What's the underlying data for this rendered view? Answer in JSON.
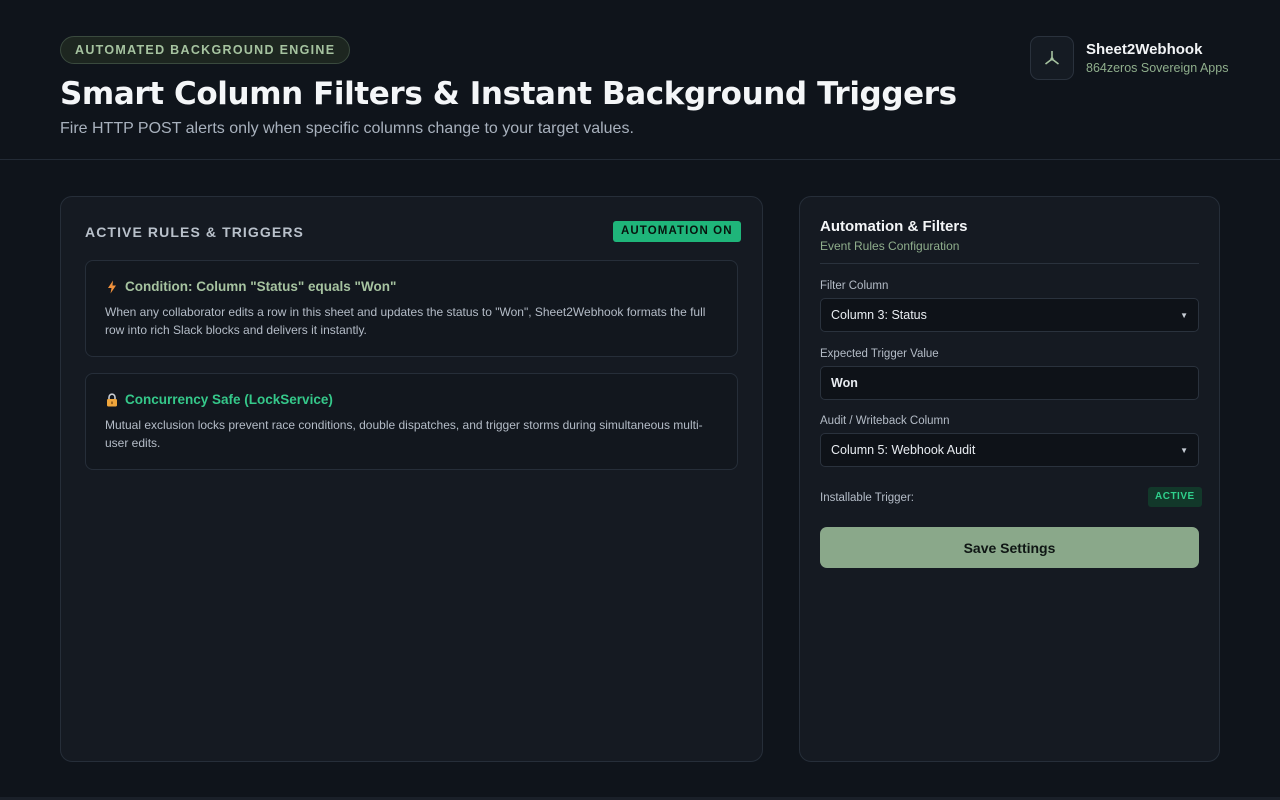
{
  "header": {
    "badge": "AUTOMATED BACKGROUND ENGINE",
    "title": "Smart Column Filters & Instant Background Triggers",
    "subtitle": "Fire HTTP POST alerts only when specific columns change to your target values."
  },
  "brand": {
    "name": "Sheet2Webhook",
    "tagline": "864zeros Sovereign Apps",
    "icon": "webhook-icon"
  },
  "rules_panel": {
    "title": "ACTIVE RULES & TRIGGERS",
    "status_badge": "AUTOMATION ON",
    "rules": [
      {
        "icon": "lightning-icon",
        "title": "Condition: Column \"Status\" equals \"Won\"",
        "description": "When any collaborator edits a row in this sheet and updates the status to \"Won\", Sheet2Webhook formats the full row into rich Slack blocks and delivers it instantly."
      },
      {
        "icon": "lock-icon",
        "title": "Concurrency Safe (LockService)",
        "description": "Mutual exclusion locks prevent race conditions, double dispatches, and trigger storms during simultaneous multi-user edits."
      }
    ]
  },
  "settings_panel": {
    "title": "Automation & Filters",
    "subtitle": "Event Rules Configuration",
    "filter_column": {
      "label": "Filter Column",
      "value": "Column 3: Status"
    },
    "trigger_value": {
      "label": "Expected Trigger Value",
      "value": "Won"
    },
    "audit_column": {
      "label": "Audit / Writeback Column",
      "value": "Column 5: Webhook Audit"
    },
    "installable_trigger": {
      "label": "Installable Trigger:",
      "status": "ACTIVE"
    },
    "save_label": "Save Settings"
  },
  "colors": {
    "accent": "#8aa88a",
    "success": "#1fb57a",
    "background": "#0f141b"
  }
}
